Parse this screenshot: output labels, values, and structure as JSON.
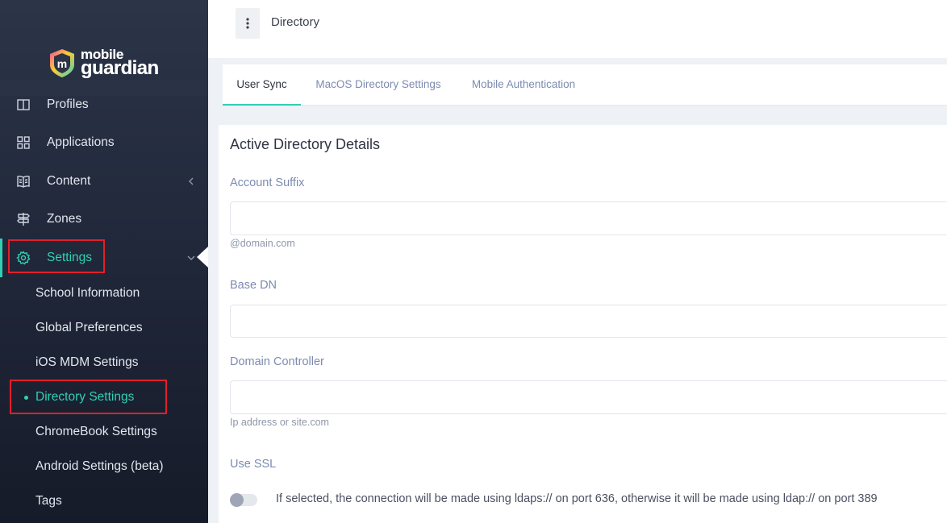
{
  "logo": {
    "line1": "mobile",
    "line2": "guardian",
    "mark_letter": "m"
  },
  "sidebar": {
    "items": [
      {
        "label": "Profiles",
        "icon": "profiles-icon"
      },
      {
        "label": "Applications",
        "icon": "grid-icon"
      },
      {
        "label": "Content",
        "icon": "book-icon"
      },
      {
        "label": "Zones",
        "icon": "signpost-icon"
      },
      {
        "label": "Settings",
        "icon": "gear-icon"
      }
    ],
    "settings_subitems": [
      "School Information",
      "Global Preferences",
      "iOS MDM Settings",
      "Directory Settings",
      "ChromeBook Settings",
      "Android Settings (beta)",
      "Tags"
    ],
    "active_item": "Settings",
    "active_subitem": "Directory Settings"
  },
  "header": {
    "title": "Directory"
  },
  "tabs": [
    {
      "label": "User Sync"
    },
    {
      "label": "MacOS Directory Settings"
    },
    {
      "label": "Mobile Authentication"
    }
  ],
  "form": {
    "section_title": "Active Directory Details",
    "account_suffix": {
      "label": "Account Suffix",
      "value": "",
      "hint": "@domain.com"
    },
    "base_dn": {
      "label": "Base DN",
      "value": ""
    },
    "domain_controller": {
      "label": "Domain Controller",
      "value": "",
      "hint": "Ip address or site.com"
    },
    "use_ssl": {
      "label": "Use SSL",
      "enabled": false,
      "description": "If selected, the connection will be made using ldaps:// on port 636, otherwise it will be made using ldap:// on port 389"
    }
  },
  "colors": {
    "accent": "#31d0b4",
    "highlight": "#e0202a",
    "sidebar_bg": "#1f2638"
  }
}
